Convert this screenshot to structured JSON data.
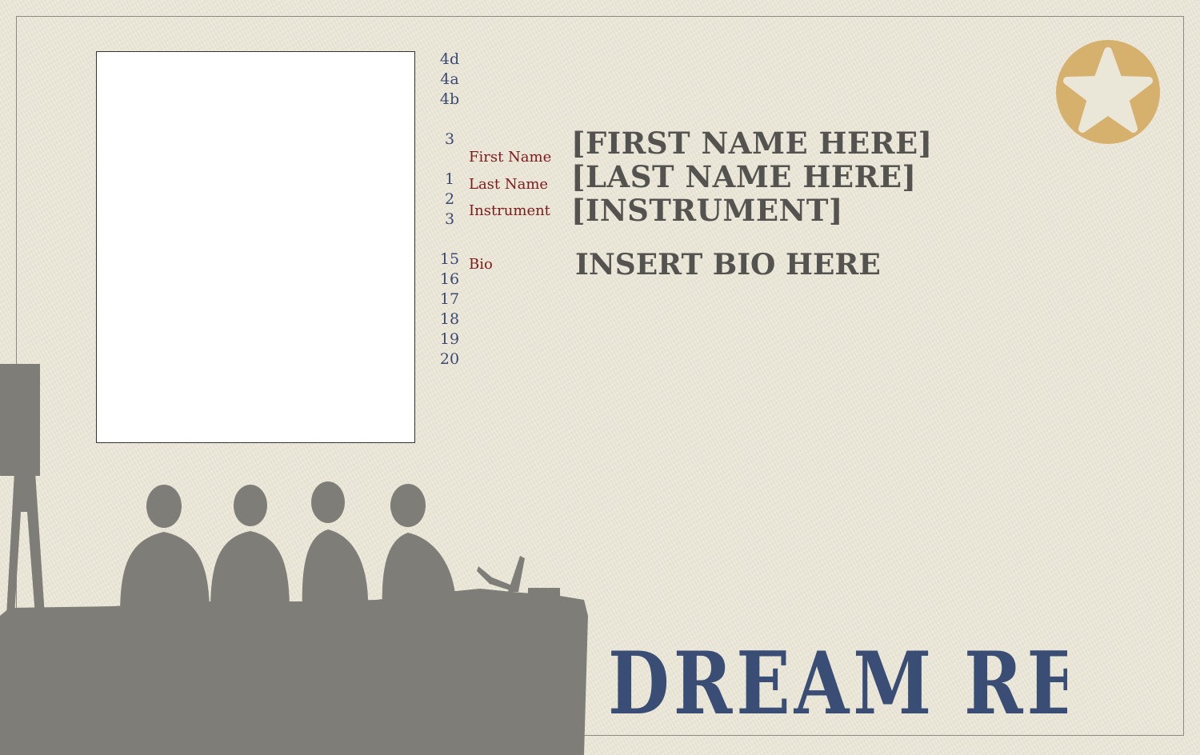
{
  "markers": {
    "m1": "4d",
    "m2": "4a",
    "m3": "4b",
    "m4": "3",
    "m5": "1",
    "m6": "2",
    "m7": "3",
    "m8": "15",
    "m9": "16",
    "m10": "17",
    "m11": "18",
    "m12": "19",
    "m13": "20"
  },
  "fields": {
    "first_name_label": "First Name",
    "first_name_value": "[FIRST NAME HERE]",
    "last_name_label": "Last Name",
    "last_name_value": "[LAST NAME HERE]",
    "instrument_label": "Instrument",
    "instrument_value": "[INSTRUMENT]",
    "bio_label": "Bio",
    "bio_value": "INSERT BIO HERE"
  },
  "brand": {
    "title": "DREAM REGIME"
  },
  "icons": {
    "badge": "star-badge-icon",
    "photo": "photo-placeholder",
    "illustration": "band-silhouette-illustration"
  },
  "colors": {
    "background": "#ebe7d8",
    "label_red": "#7d1a1a",
    "marker_blue": "#3a4a72",
    "value_gray": "#555350",
    "brand_blue": "#3a4d75",
    "star_gold": "#d6b06d",
    "silhouette_gray": "#7f7d78"
  }
}
